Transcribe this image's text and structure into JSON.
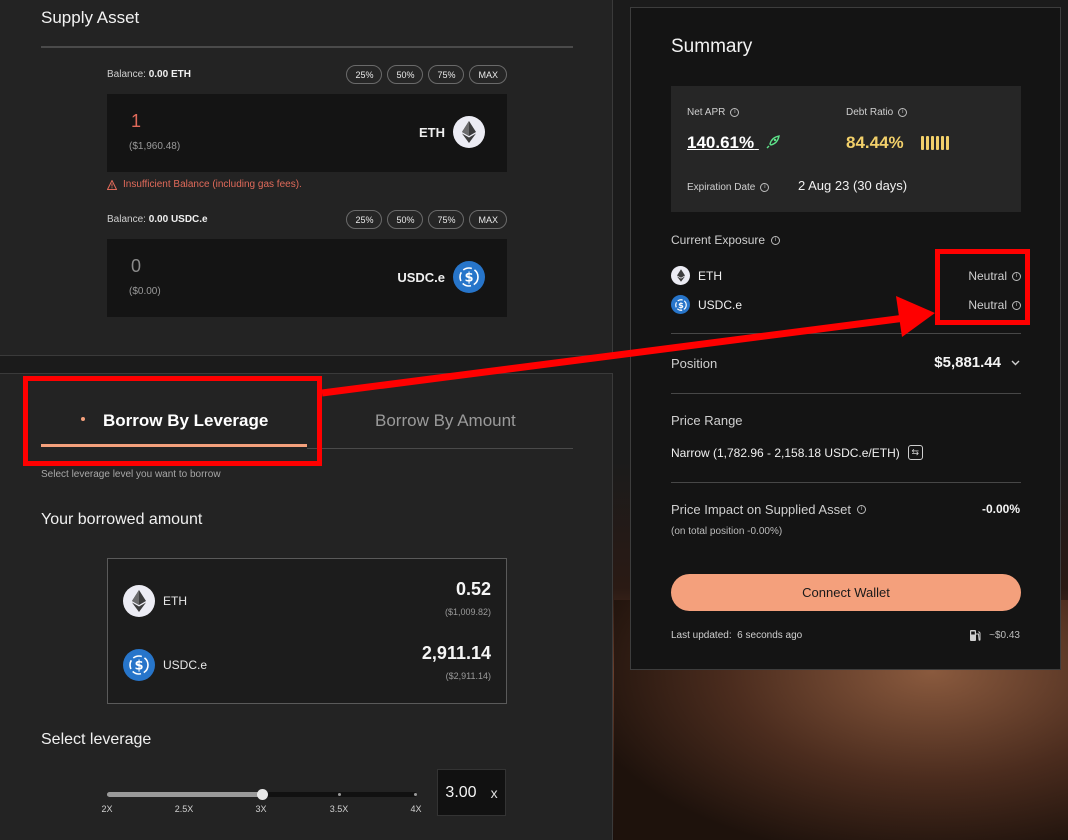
{
  "supply": {
    "title": "Supply Asset",
    "percent_buttons": [
      "25%",
      "50%",
      "75%",
      "MAX"
    ],
    "eth": {
      "balance_label": "Balance:",
      "balance_value": "0.00 ETH",
      "amount": "1",
      "amount_usd": "($1,960.48)",
      "asset": "ETH"
    },
    "warning": "Insufficient Balance (including gas fees).",
    "usdc": {
      "balance_label": "Balance:",
      "balance_value": "0.00 USDC.e",
      "amount": "0",
      "amount_usd": "($0.00)",
      "asset": "USDC.e"
    }
  },
  "borrow": {
    "tabs": [
      "Borrow By Leverage",
      "Borrow By Amount"
    ],
    "active_tab": "Borrow By Leverage",
    "hint": "Select leverage level you want to borrow",
    "borrowed_title": "Your borrowed amount",
    "rows": [
      {
        "asset": "ETH",
        "amount": "0.52",
        "usd": "($1,009.82)"
      },
      {
        "asset": "USDC.e",
        "amount": "2,911.14",
        "usd": "($2,911.14)"
      }
    ],
    "leverage_title": "Select leverage",
    "leverage_marks": [
      "2X",
      "2.5X",
      "3X",
      "3.5X",
      "4X"
    ],
    "leverage_fraction": 0.5,
    "leverage_value": "3.00",
    "leverage_unit": "x"
  },
  "summary": {
    "title": "Summary",
    "net_apr_label": "Net APR",
    "net_apr": "140.61%",
    "debt_ratio_label": "Debt Ratio",
    "debt_ratio": "84.44%",
    "expiration_label": "Expiration Date",
    "expiration": "2 Aug 23 (30 days)",
    "exposure_title": "Current Exposure",
    "exposure": [
      {
        "asset": "ETH",
        "status": "Neutral"
      },
      {
        "asset": "USDC.e",
        "status": "Neutral"
      }
    ],
    "position_label": "Position",
    "position_value": "$5,881.44",
    "price_range_label": "Price Range",
    "price_range_value": "Narrow (1,782.96 - 2,158.18 USDC.e/ETH)",
    "impact_label": "Price Impact on Supplied Asset",
    "impact_value": "-0.00%",
    "impact_sub": "(on total position -0.00%)",
    "connect_label": "Connect Wallet",
    "updated_label": "Last updated:",
    "updated_value": "6 seconds ago",
    "gas_fee": "~$0.43"
  },
  "colors": {
    "accent": "#f4a07c",
    "warning": "#e06a5a",
    "debt": "#f2d06a",
    "usdc": "#2775ca",
    "highlight": "#ff0000"
  }
}
